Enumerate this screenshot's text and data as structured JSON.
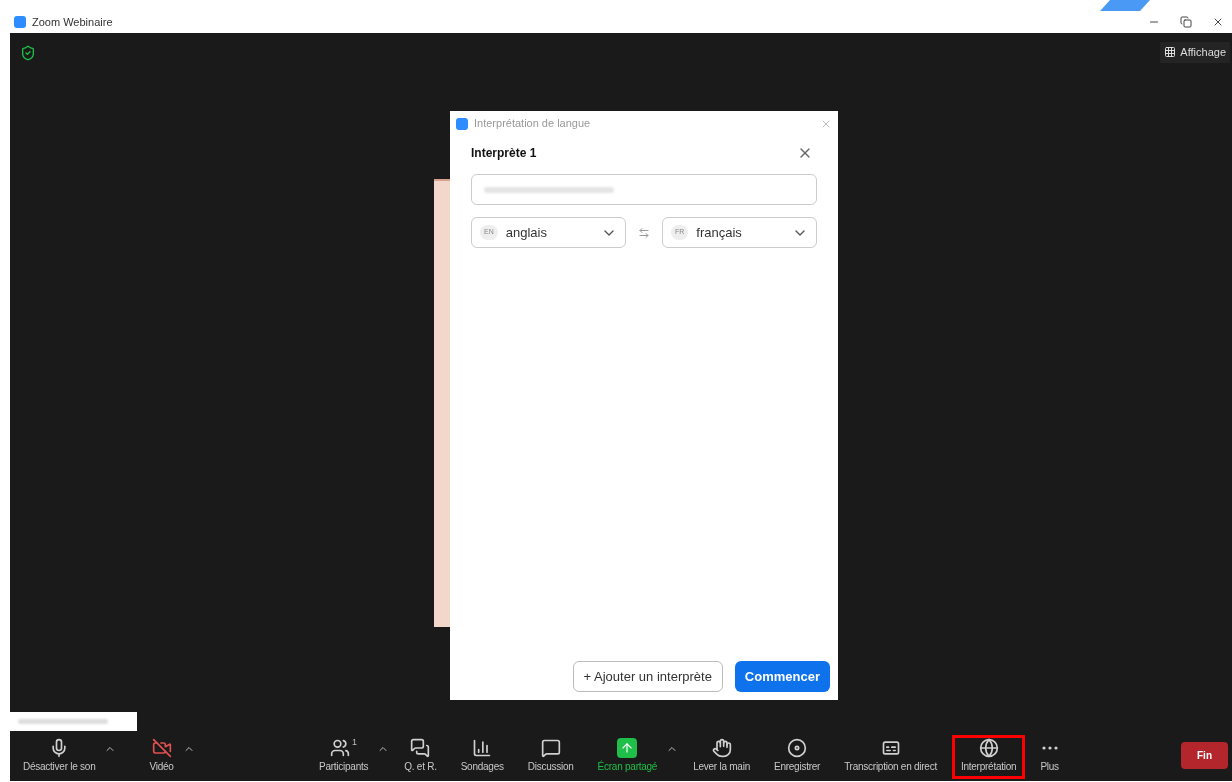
{
  "window": {
    "title": "Zoom Webinaire"
  },
  "view_button": {
    "label": "Affichage"
  },
  "dialog": {
    "title": "Interprétation de langue",
    "interpreter": {
      "heading": "Interprète 1",
      "languages": [
        {
          "code": "EN",
          "name": "anglais"
        },
        {
          "code": "FR",
          "name": "français"
        }
      ]
    },
    "buttons": [
      {
        "label": "+ Ajouter un interprète",
        "kind": "secondary"
      },
      {
        "label": "Commencer",
        "kind": "primary"
      }
    ]
  },
  "toolbar": {
    "left": [
      {
        "label": "Désactiver le son",
        "kind": "mic",
        "caret": true
      },
      {
        "label": "Vidéo",
        "kind": "video",
        "caret": true,
        "muted": true
      }
    ],
    "center": [
      {
        "label": "Participants",
        "kind": "participants",
        "count": "1",
        "caret": true,
        "highlighted": false
      },
      {
        "label": "Q. et R.",
        "kind": "qa",
        "caret": false,
        "highlighted": false
      },
      {
        "label": "Sondages",
        "kind": "polls",
        "caret": false,
        "highlighted": false
      },
      {
        "label": "Discussion",
        "kind": "chat",
        "caret": false,
        "highlighted": false
      },
      {
        "label": "Écran partagé",
        "kind": "share",
        "caret": true,
        "highlighted": false
      },
      {
        "label": "Lever la main",
        "kind": "hand",
        "caret": false,
        "highlighted": false
      },
      {
        "label": "Enregistrer",
        "kind": "record",
        "caret": false,
        "highlighted": false
      },
      {
        "label": "Transcription en direct",
        "kind": "cc",
        "caret": false,
        "highlighted": false
      },
      {
        "label": "Interprétation",
        "kind": "globe",
        "caret": false,
        "highlighted": true
      },
      {
        "label": "Plus",
        "kind": "more",
        "caret": false,
        "highlighted": false
      }
    ],
    "end_button": {
      "label": "Fin"
    }
  }
}
